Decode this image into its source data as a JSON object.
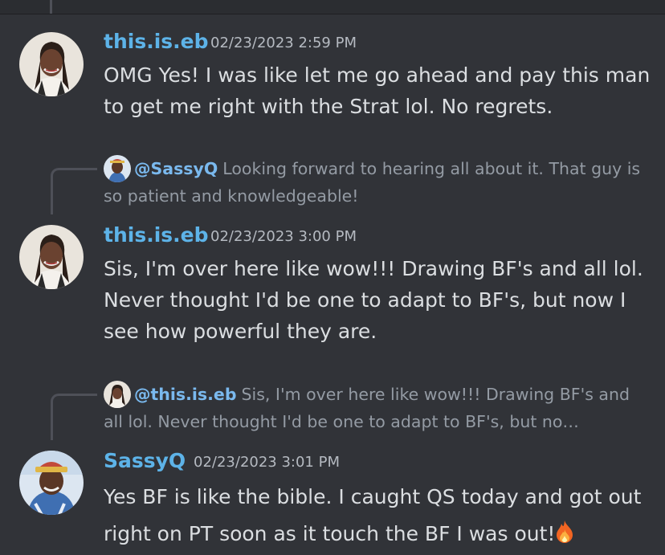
{
  "messages": [
    {
      "author": "this.is.eb",
      "timestamp": "02/23/2023 2:59 PM",
      "text": "OMG Yes! I was like let me go ahead and pay this man to get me right with the Strat lol. No regrets.",
      "avatar_icon": "avatar-this-is-eb"
    },
    {
      "reply": {
        "mention": "@SassyQ",
        "snippet": "Looking forward to hearing all about it. That guy is so patient and knowledgeable!",
        "avatar_icon": "avatar-sassyq"
      },
      "author": "this.is.eb",
      "timestamp": "02/23/2023 3:00 PM",
      "text": "Sis, I'm over here like wow!!! Drawing BF's and all lol. Never thought I'd be one to adapt to BF's, but now I see how powerful they are.",
      "avatar_icon": "avatar-this-is-eb"
    },
    {
      "reply": {
        "mention": "@this.is.eb",
        "snippet": "Sis, I'm over here like wow!!! Drawing BF's and all lol. Never thought I'd be one to adapt to BF's, but no…",
        "avatar_icon": "avatar-this-is-eb"
      },
      "author": "SassyQ",
      "timestamp": "02/23/2023 3:01 PM",
      "text": "Yes BF is like the bible. I caught QS today and got out right on PT soon as it touch the BF I was out!",
      "emoji": "fire-emoji"
    }
  ],
  "colors": {
    "background": "#313338",
    "username": "#5db3e8",
    "message_text": "#dbdee1",
    "reply_text": "#949ba4",
    "reply_mention": "#7ab9ee",
    "timestamp": "#b5bac1"
  }
}
